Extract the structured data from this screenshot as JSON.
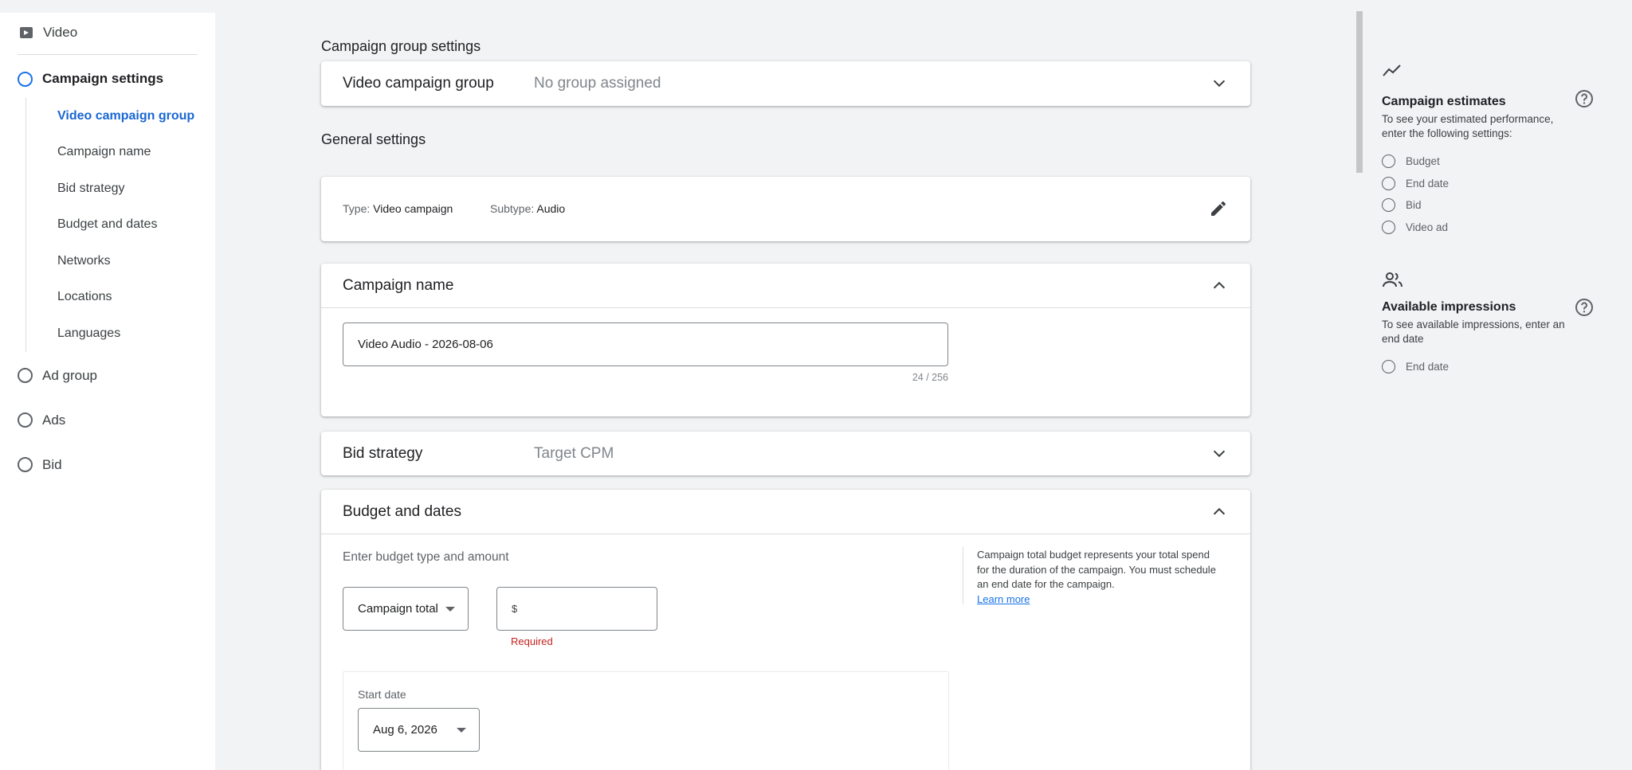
{
  "nav": {
    "top_item": "Video",
    "campaign_settings": "Campaign settings",
    "sub_items": [
      "Video campaign group",
      "Campaign name",
      "Bid strategy",
      "Budget and dates",
      "Networks",
      "Locations",
      "Languages"
    ],
    "ad_group": "Ad group",
    "ads": "Ads",
    "bid": "Bid"
  },
  "campaign_group": {
    "section_title": "Campaign group settings",
    "label": "Video campaign group",
    "value": "No group assigned"
  },
  "general": {
    "section_title": "General settings",
    "type_label": "Type:",
    "type_value": "Video campaign",
    "subtype_label": "Subtype:",
    "subtype_value": "Audio"
  },
  "campaign_name": {
    "title": "Campaign name",
    "input_value": "Video Audio - 2026-08-06",
    "counter": "24 / 256"
  },
  "bid_strategy": {
    "label": "Bid strategy",
    "value": "Target CPM"
  },
  "budget": {
    "title": "Budget and dates",
    "prompt": "Enter budget type and amount",
    "budget_type": "Campaign total",
    "currency": "$",
    "amount_value": "",
    "error": "Required",
    "help_text": "Campaign total budget represents your total spend for the duration of the campaign. You must schedule an end date for the campaign.",
    "learn_more": "Learn more",
    "start_date_label": "Start date",
    "start_date_value": "Aug 6, 2026"
  },
  "right_panel": {
    "estimates_title": "Campaign estimates",
    "estimates_desc": "To see your estimated performance, enter the following settings:",
    "estimates_items": [
      "Budget",
      "End date",
      "Bid",
      "Video ad"
    ],
    "impressions_title": "Available impressions",
    "impressions_desc": "To see available impressions, enter an end date",
    "impressions_items": [
      "End date"
    ]
  },
  "colors": {
    "accent": "#1a73e8",
    "active_nav": "#1967d2",
    "error": "#c5221f",
    "background": "#f1f3f4"
  }
}
